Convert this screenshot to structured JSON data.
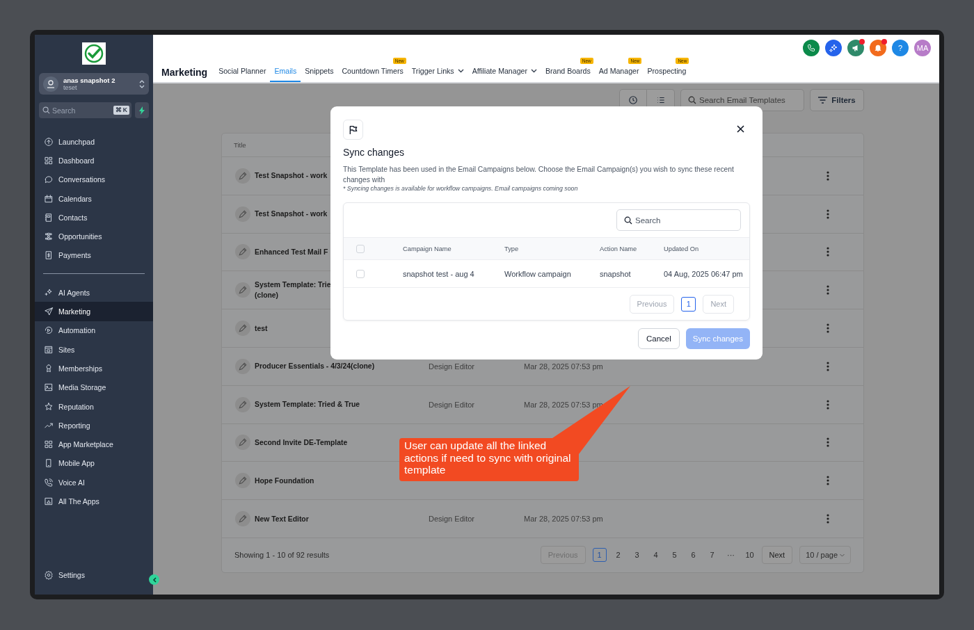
{
  "sidebar": {
    "account": {
      "name": "anas snapshot 2",
      "subtitle": "teset"
    },
    "search": {
      "placeholder": "Search",
      "shortcut": "⌘ K"
    },
    "nav_groups": [
      [
        {
          "label": "Launchpad",
          "selected": false
        },
        {
          "label": "Dashboard",
          "selected": false
        },
        {
          "label": "Conversations",
          "selected": false
        },
        {
          "label": "Calendars",
          "selected": false
        },
        {
          "label": "Contacts",
          "selected": false
        },
        {
          "label": "Opportunities",
          "selected": false
        },
        {
          "label": "Payments",
          "selected": false
        }
      ],
      [
        {
          "label": "AI Agents",
          "selected": false
        },
        {
          "label": "Marketing",
          "selected": true
        },
        {
          "label": "Automation",
          "selected": false
        },
        {
          "label": "Sites",
          "selected": false
        },
        {
          "label": "Memberships",
          "selected": false
        },
        {
          "label": "Media Storage",
          "selected": false
        },
        {
          "label": "Reputation",
          "selected": false
        },
        {
          "label": "Reporting",
          "selected": false
        },
        {
          "label": "App Marketplace",
          "selected": false
        },
        {
          "label": "Mobile App",
          "selected": false
        },
        {
          "label": "Voice AI",
          "selected": false
        },
        {
          "label": "All The Apps",
          "selected": false
        }
      ]
    ],
    "settings": {
      "label": "Settings"
    }
  },
  "header": {
    "title": "Marketing",
    "tabs": [
      {
        "label": "Social Planner",
        "selected": false,
        "has_menu": false
      },
      {
        "label": "Emails",
        "selected": true,
        "has_menu": false
      },
      {
        "label": "Snippets",
        "selected": false,
        "has_menu": false
      },
      {
        "label": "Countdown Timers",
        "selected": false,
        "has_menu": false,
        "badge": "New"
      },
      {
        "label": "Trigger Links",
        "selected": false,
        "has_menu": true
      },
      {
        "label": "Affiliate Manager",
        "selected": false,
        "has_menu": true
      },
      {
        "label": "Brand Boards",
        "selected": false,
        "has_menu": false,
        "badge": "New"
      },
      {
        "label": "Ad Manager",
        "selected": false,
        "has_menu": false,
        "badge": "New"
      },
      {
        "label": "Prospecting",
        "selected": false,
        "has_menu": false,
        "badge": "New"
      }
    ],
    "actions": [
      {
        "kind": "phone",
        "color": "#0b8a4a",
        "dot": false
      },
      {
        "kind": "sparkle",
        "color": "#2563eb",
        "dot": false
      },
      {
        "kind": "megaphone",
        "color": "#2f8a6a",
        "dot": true
      },
      {
        "kind": "bell",
        "color": "#f26b1d",
        "dot": true
      },
      {
        "kind": "help",
        "color": "#1e88e5",
        "dot": false,
        "text": "?"
      },
      {
        "kind": "avatar",
        "color": "#b77cc8",
        "dot": false,
        "text": "MA"
      }
    ]
  },
  "toolbar": {
    "search": {
      "placeholder": "Search Email Templates"
    },
    "filters": "Filters"
  },
  "table": {
    "columns": [
      "Title"
    ],
    "rows": [
      {
        "title": "Test Snapshot - work"
      },
      {
        "title": "Test Snapshot - work"
      },
      {
        "title": "Enhanced Test Mail F"
      },
      {
        "title": "System Template: Trie\n(clone)"
      },
      {
        "title": "test"
      },
      {
        "title": "Producer Essentials - 4/3/24(clone)",
        "type": "Design Editor",
        "updated": "Mar 28, 2025 07:53 pm"
      },
      {
        "title": "System Template: Tried & True",
        "type": "Design Editor",
        "updated": "Mar 28, 2025 07:53 pm"
      },
      {
        "title": "Second Invite DE-Template"
      },
      {
        "title": "Hope Foundation"
      },
      {
        "title": "New Text Editor",
        "type": "Design Editor",
        "updated": "Mar 28, 2025 07:53 pm"
      }
    ],
    "footer": {
      "summary": "Showing 1 - 10 of 92 results",
      "previous": "Previous",
      "next": "Next",
      "page_size": "10 / page",
      "pages": [
        {
          "label": "1",
          "selected": true
        },
        {
          "label": "2",
          "selected": false
        },
        {
          "label": "3",
          "selected": false
        },
        {
          "label": "4",
          "selected": false
        },
        {
          "label": "5",
          "selected": false
        },
        {
          "label": "6",
          "selected": false
        },
        {
          "label": "7",
          "selected": false
        },
        {
          "label": "···",
          "selected": false
        },
        {
          "label": "10",
          "selected": false
        }
      ]
    }
  },
  "modal": {
    "title": "Sync changes",
    "description": "This Template has been used in the Email Campaigns below. Choose the Email Campaign(s) you wish to sync these recent changes with",
    "note": "* Syncing changes is available for workflow campaigns. Email campaigns coming soon",
    "search": {
      "placeholder": "Search"
    },
    "select_all": {
      "checked": false
    },
    "columns": [
      "Campaign Name",
      "Type",
      "Action Name",
      "Updated On"
    ],
    "rows": [
      {
        "checked": false,
        "cells": [
          "snapshot test - aug 4",
          "Workflow campaign",
          "snapshot",
          "04 Aug, 2025 06:47 pm"
        ]
      }
    ],
    "pagination": {
      "previous": "Previous",
      "next": "Next",
      "pages": [
        {
          "label": "1",
          "selected": true
        }
      ]
    },
    "cancel": "Cancel",
    "confirm": {
      "label": "Sync changes",
      "disabled": true
    }
  },
  "callout": {
    "text": "User can update all the linked actions if need to sync with original template"
  }
}
